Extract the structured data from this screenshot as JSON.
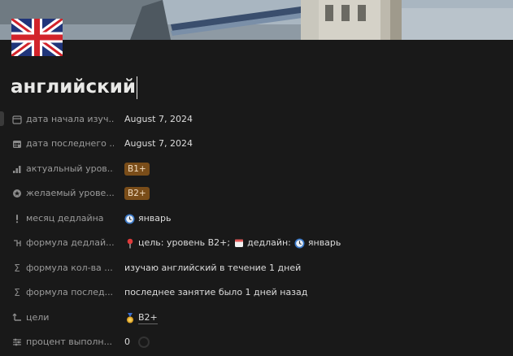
{
  "page": {
    "title": "английский"
  },
  "properties": [
    {
      "icon": "calendar-icon",
      "name": "дата начала изуч...",
      "value": "August 7, 2024",
      "type": "date"
    },
    {
      "icon": "calendar-grid-icon",
      "name": "дата последнего ...",
      "value": "August 7, 2024",
      "type": "date"
    },
    {
      "icon": "bar-chart-icon",
      "name": "актуальный уров...",
      "value": "B1+",
      "type": "select"
    },
    {
      "icon": "star-circle-icon",
      "name": "желаемый урове...",
      "value": "B2+",
      "type": "select"
    },
    {
      "icon": "exclamation-icon",
      "name": "месяц дедлайна",
      "value": "январь",
      "type": "relation",
      "emoji": "clock-icon"
    },
    {
      "icon": "formula-icon",
      "name": "формула дедлай...",
      "type": "formula-rich",
      "parts": [
        "цель: уровень B2+;",
        "дедлайн:",
        "январь"
      ]
    },
    {
      "icon": "sigma-icon",
      "name": "формула кол-ва ...",
      "value": "изучаю английский в течение 1 дней",
      "type": "text"
    },
    {
      "icon": "sigma-icon",
      "name": "формула послед...",
      "value": "последнее занятие было 1 дней назад",
      "type": "text"
    },
    {
      "icon": "relation-arrow-icon",
      "name": "цели",
      "value": "B2+",
      "type": "relation",
      "emoji": "medal-icon"
    },
    {
      "icon": "sliders-icon",
      "name": "процент выполн...",
      "value": "0",
      "type": "progress",
      "progress_fraction": 0
    }
  ],
  "colors": {
    "background": "#191919",
    "tag_bg": "#7a4d19",
    "tag_text": "#f1dcc0",
    "muted": "#9b9b9b"
  }
}
